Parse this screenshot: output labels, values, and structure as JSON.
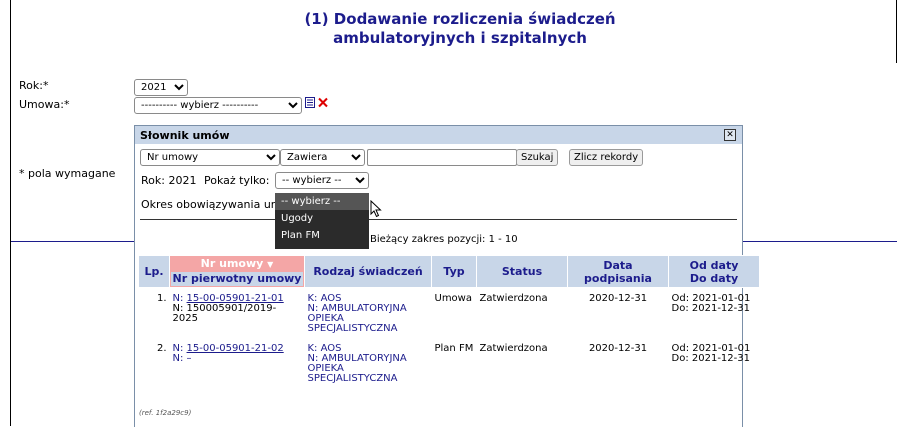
{
  "page_title": "(1) Dodawanie rozliczenia świadczeń ambulatoryjnych i szpitalnych",
  "form": {
    "rok_label": "Rok:*",
    "rok_value": "2021",
    "umowa_label": "Umowa:*",
    "umowa_value": "---------- wybierz ----------",
    "required_note": "* pola wymagane"
  },
  "dialog": {
    "title": "Słownik umów",
    "field_select": "Nr umowy",
    "operator_select": "Zawiera",
    "search_value": "",
    "search_button": "Szukaj",
    "count_button": "Zlicz rekordy",
    "rok_text": "Rok: 2021",
    "pokaz_label": "Pokaż tylko:",
    "pokaz_value": "-- wybierz --",
    "okres_label": "Okres obowiązywania um",
    "range_text": "Bieżący zakres pozycji: 1 - 10",
    "ref": "(ref. 1f2a29c9)",
    "dropdown_options": [
      "-- wybierz --",
      "Ugody",
      "Plan FM"
    ]
  },
  "table": {
    "headers": {
      "lp": "Lp.",
      "nr_umowy": "Nr umowy",
      "nr_pierwotny": "Nr pierwotny umowy",
      "rodzaj": "Rodzaj świadczeń",
      "typ": "Typ",
      "status": "Status",
      "data_podpisania": "Data podpisania",
      "od_daty": "Od daty",
      "do_daty": "Do daty"
    },
    "rows": [
      {
        "lp": "1.",
        "n_prefix": "N:",
        "nr": "15-00-05901-21-01",
        "nr_pierwotny": "N: 150005901/2019-2025",
        "rodzaj_k": "K: AOS",
        "rodzaj_n": "N: AMBULATORYJNA OPIEKA SPECJALISTYCZNA",
        "typ": "Umowa",
        "status": "Zatwierdzona",
        "data": "2020-12-31",
        "od": "Od: 2021-01-01",
        "do": "Do: 2021-12-31"
      },
      {
        "lp": "2.",
        "n_prefix": "N:",
        "nr": "15-00-05901-21-02",
        "nr_pierwotny": "N: –",
        "rodzaj_k": "K: AOS",
        "rodzaj_n": "N: AMBULATORYJNA OPIEKA SPECJALISTYCZNA",
        "typ": "Plan FM",
        "status": "Zatwierdzona",
        "data": "2020-12-31",
        "od": "Od: 2021-01-01",
        "do": "Do: 2021-12-31"
      }
    ]
  }
}
